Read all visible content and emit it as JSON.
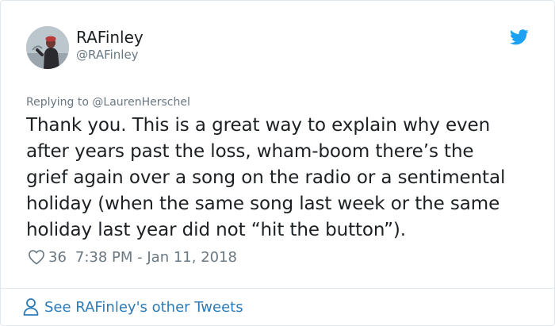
{
  "author": {
    "display_name": "RAFinley",
    "handle": "@RAFinley",
    "avatar_icon": "profile-photo"
  },
  "brand": {
    "icon": "twitter-bird-icon",
    "color": "#1da1f2"
  },
  "reply": {
    "prefix": "Replying to",
    "mention": "@LaurenHerschel"
  },
  "tweet": {
    "lines": [
      "Thank you. This is a great way to explain why even",
      "after years past the loss, wham-boom there’s the",
      "grief again over a song on the radio or a sentimental",
      "holiday (when the same song last week or the same",
      "holiday last year did not “hit the button”)."
    ]
  },
  "meta": {
    "like_icon": "heart-icon",
    "likes": "36",
    "timestamp": "7:38 PM - Jan 11, 2018"
  },
  "footer": {
    "icon": "person-icon",
    "label": "See RAFinley's other Tweets",
    "link_color": "#2b7bb9"
  },
  "colors": {
    "text": "#1c2022",
    "muted": "#697882",
    "border": "#e1e8ed"
  }
}
